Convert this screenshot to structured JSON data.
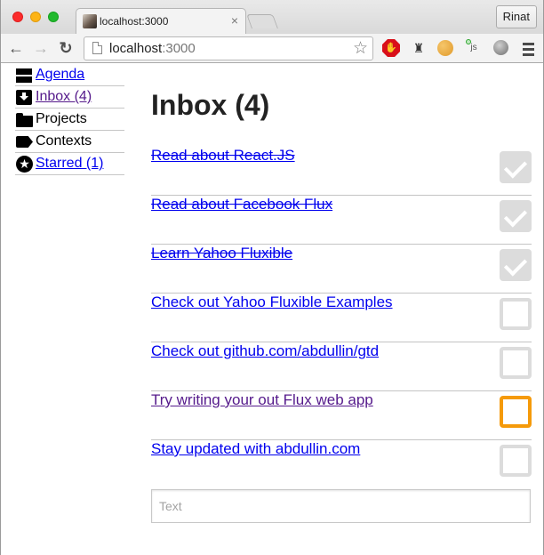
{
  "browser": {
    "tab_title": "localhost:3000",
    "tab_close": "×",
    "profile_name": "Rinat",
    "url_host": "localhost",
    "url_port": ":3000",
    "back_glyph": "←",
    "forward_glyph": "→",
    "reload_glyph": "↻",
    "star_glyph": "☆",
    "extensions": [
      {
        "name": "adblock-icon"
      },
      {
        "name": "lamp-icon",
        "glyph": "♜"
      },
      {
        "name": "cookie-icon"
      },
      {
        "name": "js-icon",
        "label": "js"
      },
      {
        "name": "globe-icon"
      }
    ]
  },
  "sidebar": {
    "items": [
      {
        "label": "Agenda",
        "icon": "agenda-icon",
        "link": true,
        "visited": false
      },
      {
        "label": "Inbox (4)",
        "icon": "inbox-icon",
        "link": true,
        "visited": true
      },
      {
        "label": "Projects",
        "icon": "folder-icon",
        "link": false
      },
      {
        "label": "Contexts",
        "icon": "tag-icon",
        "link": false
      },
      {
        "label": "Starred (1)",
        "icon": "star-circle-icon",
        "link": true,
        "visited": false
      }
    ]
  },
  "main": {
    "title": "Inbox (4)",
    "todos": [
      {
        "label": "Read about React.JS",
        "done": true
      },
      {
        "label": "Read about Facebook Flux",
        "done": true
      },
      {
        "label": "Learn Yahoo Fluxible",
        "done": true
      },
      {
        "label": "Check out Yahoo Fluxible Examples",
        "done": false
      },
      {
        "label": "Check out github.com/abdullin/gtd",
        "done": false
      },
      {
        "label": "Try writing your out Flux web app",
        "done": false,
        "visited": true,
        "focused": true
      },
      {
        "label": "Stay updated with abdullin.com",
        "done": false
      }
    ],
    "new_todo": {
      "placeholder": "Text",
      "value": ""
    }
  },
  "colors": {
    "link": "#0000ee",
    "visited": "#551a8b",
    "focus": "#f59a0a",
    "check_bg": "#dcdcdc"
  }
}
